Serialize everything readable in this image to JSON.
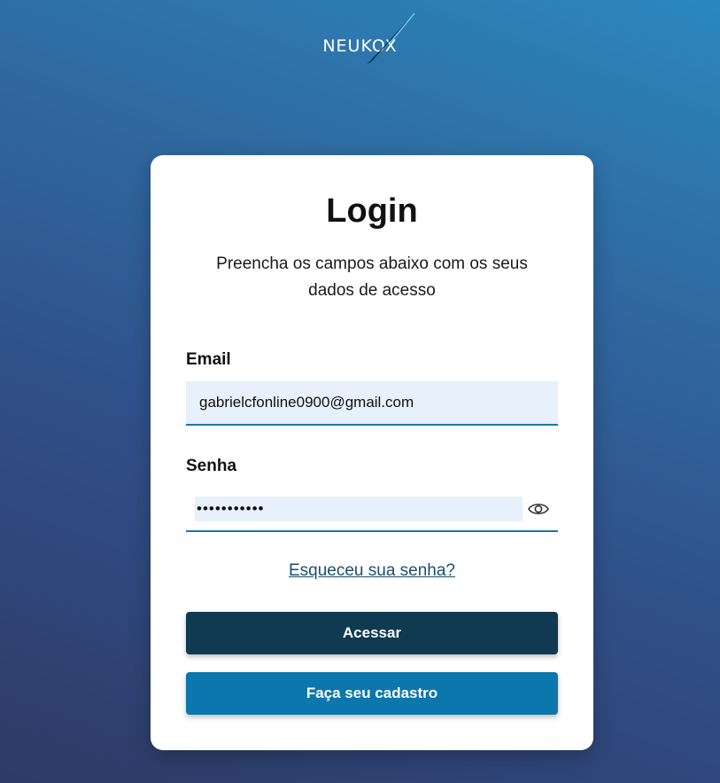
{
  "brand": {
    "name": "NEUKOX"
  },
  "login": {
    "title": "Login",
    "subtitle": "Preencha os campos abaixo com os seus dados de acesso",
    "email_label": "Email",
    "email_value": "gabrielcfonline0900@gmail.com",
    "password_label": "Senha",
    "password_value": "•••••••••••",
    "forgot_link": "Esqueceu sua senha?",
    "submit_label": "Acessar",
    "register_label": "Faça seu cadastro"
  },
  "icons": {
    "toggle_password": "eye-icon"
  },
  "colors": {
    "primary_button": "#0f3a52",
    "secondary_button": "#0b77ac",
    "input_background": "#e8f0fc",
    "input_underline": "#1a78a8",
    "link": "#1b4f6e"
  }
}
